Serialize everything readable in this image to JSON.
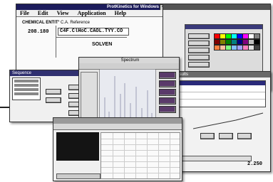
{
  "main_window": {
    "title": "ProtKinetics for Windows",
    "menu": [
      "File",
      "Edit",
      "View",
      "Application",
      "Help"
    ],
    "field_label": "CHEMICAL ENTITY",
    "field_tag": "C.A. Reference",
    "value": "208.180",
    "expression": "C4F.ClHoC.CAOL.TYY.CO",
    "solvent_label": "SOLVEN"
  },
  "small_window": {
    "title": "Sequence"
  },
  "chart_window": {
    "title": "Spectrum"
  },
  "table_window": {
    "title": "Results",
    "readout": "2.250"
  },
  "colors": {
    "title_bar": "#2a2a7a",
    "window_bg": "#f4f4f4",
    "graph_bg": "#e8eaf0",
    "spectrum_line": "#8a8aa8",
    "grid_bg": "#141414"
  },
  "palette": [
    "#ff0000",
    "#ffff00",
    "#00ff00",
    "#00ffff",
    "#0000ff",
    "#ff00ff",
    "#ffffff",
    "#808080",
    "#800000",
    "#808000",
    "#008000",
    "#008080",
    "#000080",
    "#800080",
    "#c0c0c0",
    "#000000",
    "#ff8040",
    "#ffc0a0",
    "#80ff80",
    "#80c0ff",
    "#a0a0ff",
    "#ff80c0",
    "#e0e0e0",
    "#404040"
  ],
  "icons": {
    "close": "close-icon",
    "minimize": "minimize-icon",
    "maximize": "maximize-icon",
    "scroll_arrow": "arrow-icon"
  }
}
